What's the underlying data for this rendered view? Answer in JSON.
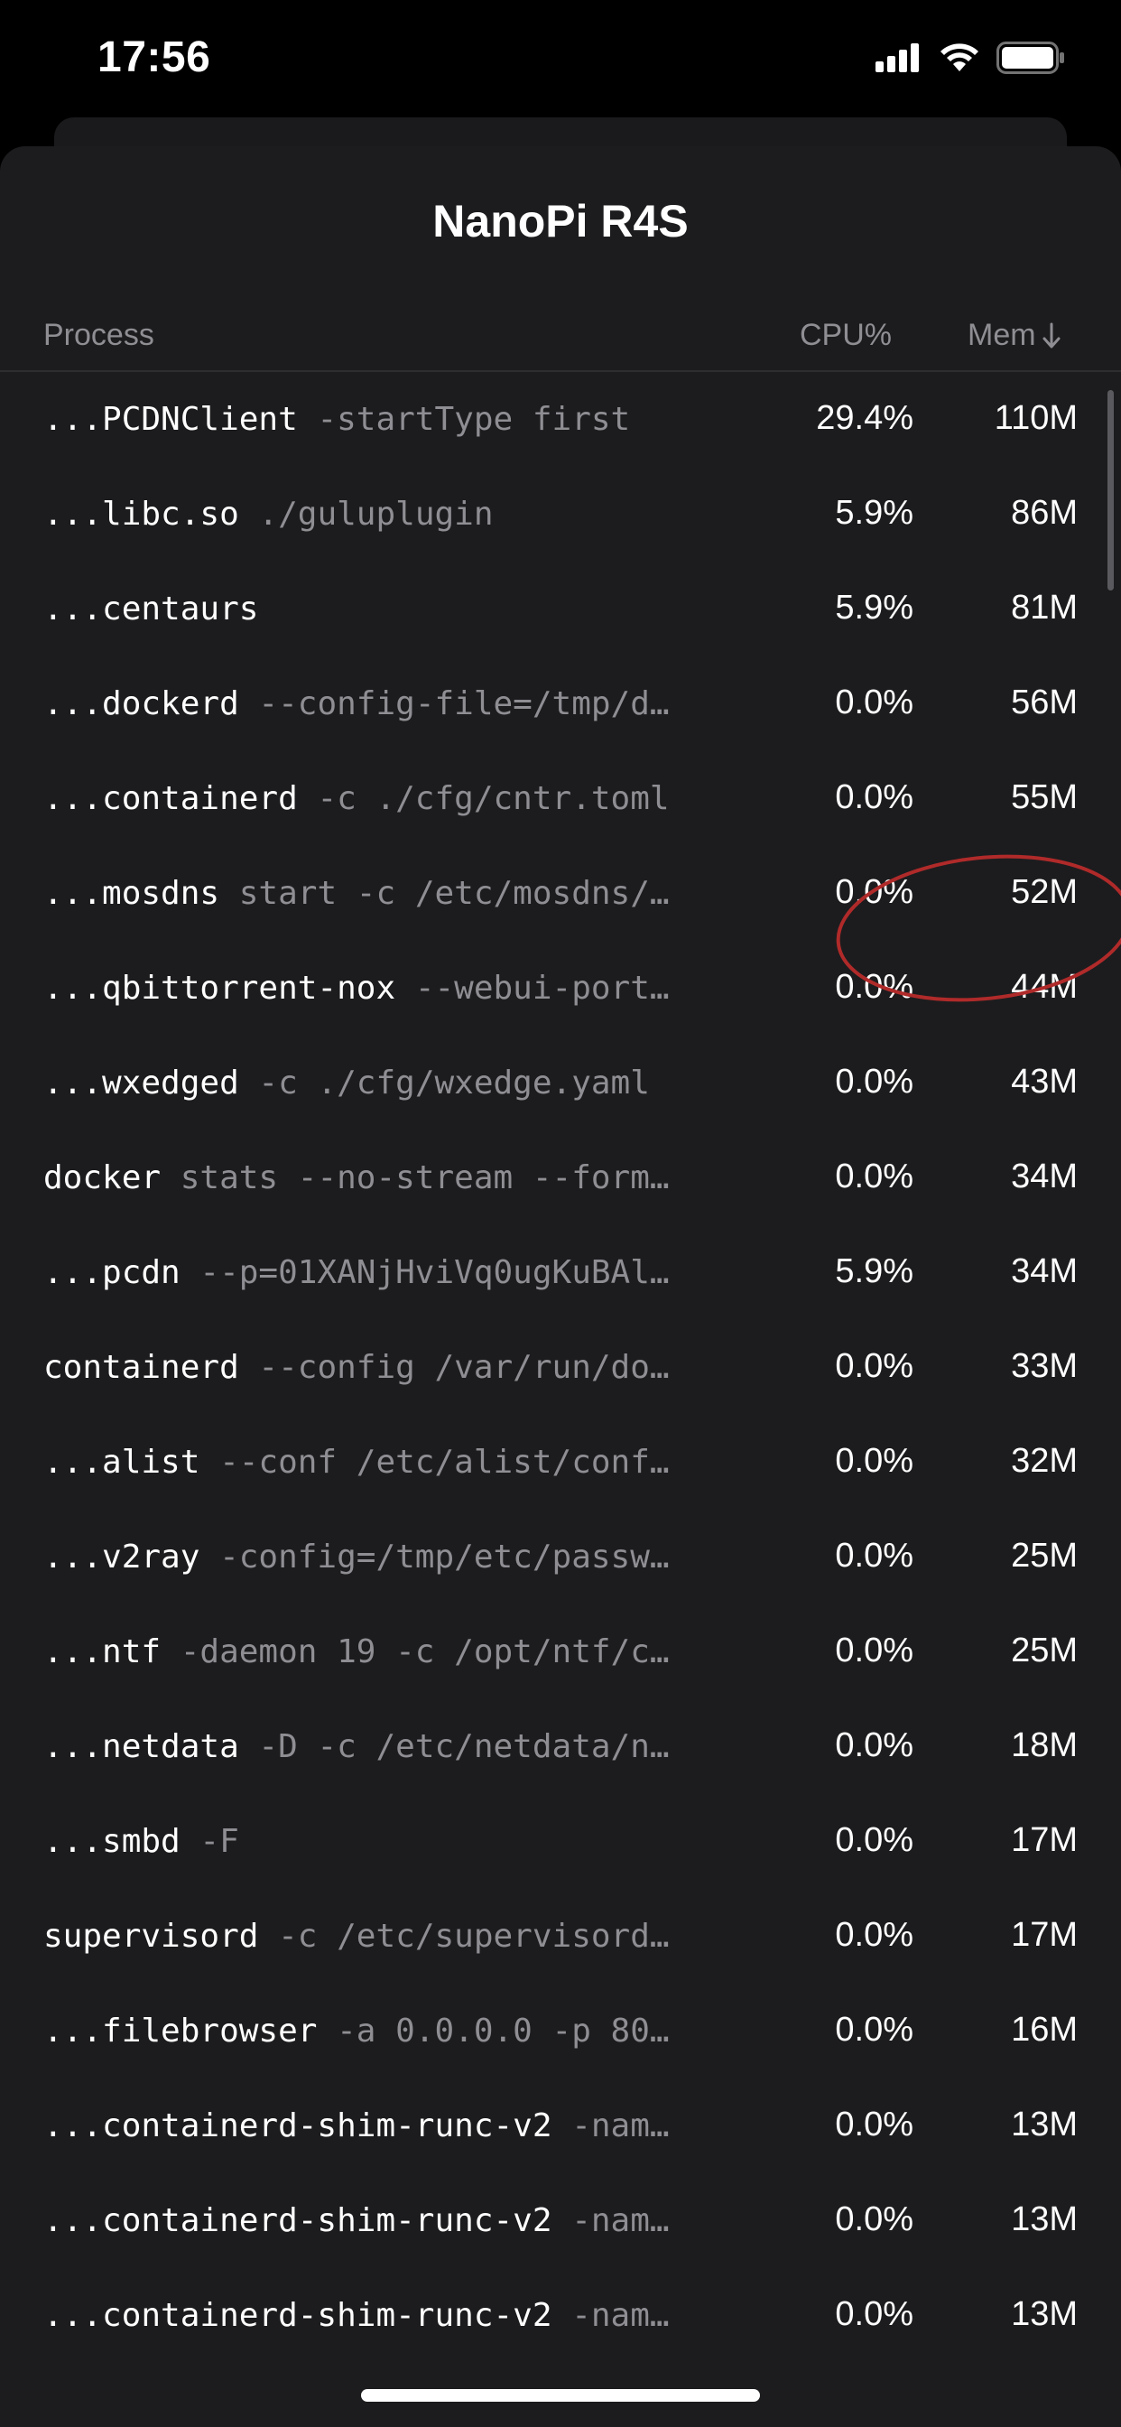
{
  "status_bar": {
    "time": "17:56"
  },
  "sheet": {
    "title": "NanoPi R4S"
  },
  "table": {
    "headers": {
      "process": "Process",
      "cpu": "CPU%",
      "mem": "Mem"
    },
    "sort_icon": "arrow-down-icon",
    "rows": [
      {
        "name": "...PCDNClient",
        "args": " -startType first",
        "cpu": "29.4%",
        "mem": "110M"
      },
      {
        "name": "...libc.so",
        "args": " ./guluplugin",
        "cpu": "5.9%",
        "mem": "86M"
      },
      {
        "name": "...centaurs",
        "args": "",
        "cpu": "5.9%",
        "mem": "81M"
      },
      {
        "name": "...dockerd",
        "args": " --config-file=/tmp/d…",
        "cpu": "0.0%",
        "mem": "56M"
      },
      {
        "name": "...containerd",
        "args": " -c ./cfg/cntr.toml",
        "cpu": "0.0%",
        "mem": "55M"
      },
      {
        "name": "...mosdns",
        "args": " start -c /etc/mosdns/…",
        "cpu": "0.0%",
        "mem": "52M"
      },
      {
        "name": "...qbittorrent-nox",
        "args": " --webui-port…",
        "cpu": "0.0%",
        "mem": "44M"
      },
      {
        "name": "...wxedged",
        "args": " -c ./cfg/wxedge.yaml",
        "cpu": "0.0%",
        "mem": "43M"
      },
      {
        "name": "docker",
        "args": " stats --no-stream --form…",
        "cpu": "0.0%",
        "mem": "34M"
      },
      {
        "name": "...pcdn",
        "args": " --p=01XANjHviVq0ugKuBAl…",
        "cpu": "5.9%",
        "mem": "34M"
      },
      {
        "name": "containerd",
        "args": " --config /var/run/do…",
        "cpu": "0.0%",
        "mem": "33M"
      },
      {
        "name": "...alist",
        "args": " --conf /etc/alist/conf…",
        "cpu": "0.0%",
        "mem": "32M"
      },
      {
        "name": "...v2ray",
        "args": " -config=/tmp/etc/passw…",
        "cpu": "0.0%",
        "mem": "25M"
      },
      {
        "name": "...ntf",
        "args": " -daemon 19 -c /opt/ntf/c…",
        "cpu": "0.0%",
        "mem": "25M"
      },
      {
        "name": "...netdata",
        "args": " -D -c /etc/netdata/n…",
        "cpu": "0.0%",
        "mem": "18M"
      },
      {
        "name": "...smbd",
        "args": " -F",
        "cpu": "0.0%",
        "mem": "17M"
      },
      {
        "name": "supervisord",
        "args": " -c /etc/supervisord…",
        "cpu": "0.0%",
        "mem": "17M"
      },
      {
        "name": "...filebrowser",
        "args": " -a 0.0.0.0 -p 80…",
        "cpu": "0.0%",
        "mem": "16M"
      },
      {
        "name": "...containerd-shim-runc-v2",
        "args": " -nam…",
        "cpu": "0.0%",
        "mem": "13M"
      },
      {
        "name": "...containerd-shim-runc-v2",
        "args": " -nam…",
        "cpu": "0.0%",
        "mem": "13M"
      },
      {
        "name": "...containerd-shim-runc-v2",
        "args": " -nam…",
        "cpu": "0.0%",
        "mem": "13M"
      }
    ]
  },
  "colors": {
    "background": "#000000",
    "sheet": "#1c1c1e",
    "text_primary": "#ffffff",
    "text_secondary": "#8e8e93",
    "annotation": "#b02a2a"
  }
}
